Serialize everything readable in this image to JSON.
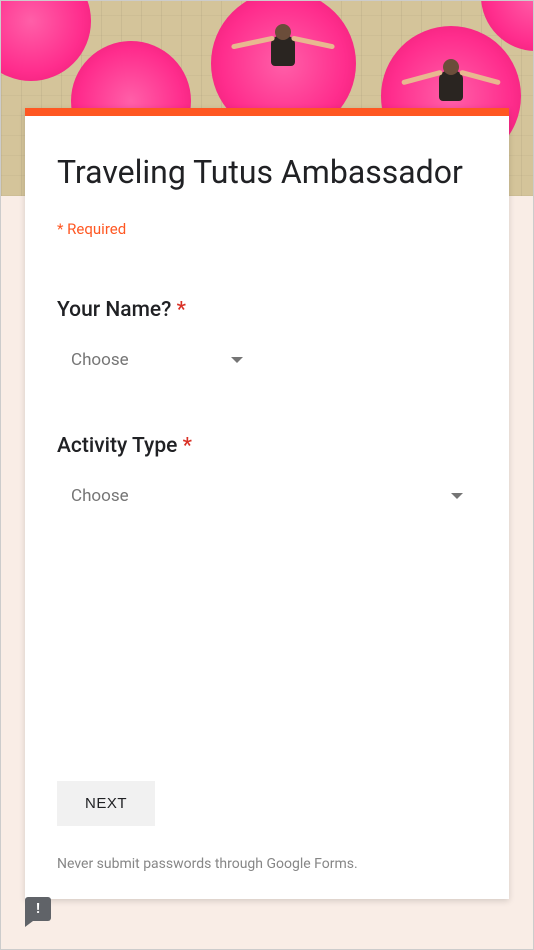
{
  "form": {
    "title": "Traveling Tutus Ambassador",
    "required_note": "* Required",
    "questions": {
      "name": {
        "label": "Your Name? ",
        "asterisk": "*",
        "placeholder": "Choose"
      },
      "activity": {
        "label": "Activity Type ",
        "asterisk": "*",
        "placeholder": "Choose"
      }
    },
    "next_label": "NEXT",
    "footer_note": "Never submit passwords through Google Forms."
  },
  "report_badge": "!"
}
